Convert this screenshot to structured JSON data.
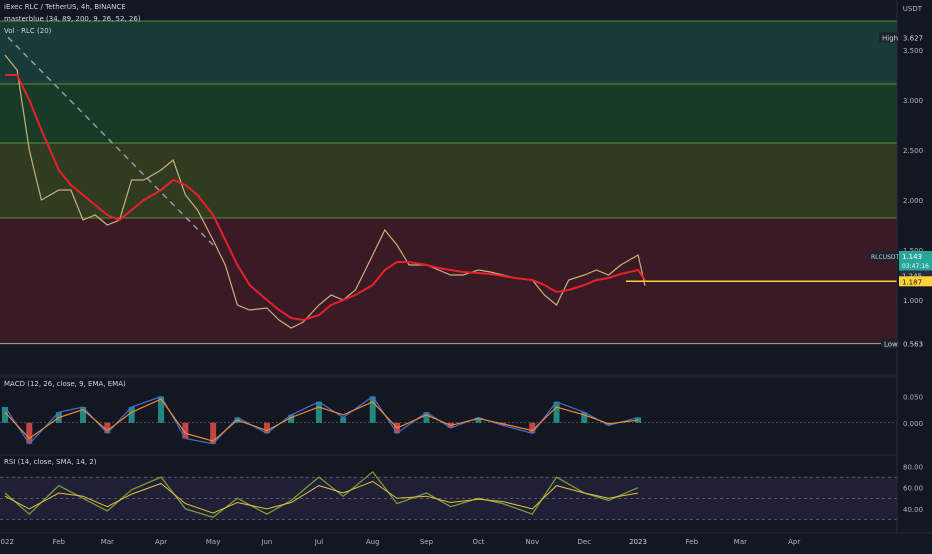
{
  "header": {
    "symbol_line": "iExec RLC / TetherUS, 4h, BINANCE",
    "indicator_line": "masterblue (34, 89, 200, 9, 26, 52, 26)",
    "volume_line": "Vol · RLC (20)",
    "currency": "USDT"
  },
  "price_axis": {
    "ticks": [
      "3.500",
      "3.000",
      "2.500",
      "2.000",
      "1.500",
      "1.000"
    ],
    "high_label": "High",
    "high_value": "3.627",
    "low_label": "Low",
    "low_value": "0.563",
    "symbol_badge": "RLCUSDT",
    "current_price": "1.143",
    "countdown": "03:47:16",
    "level_value_1": "1.245",
    "level_value_2": "1.187"
  },
  "macd": {
    "label": "MACD (12, 26, close, 9, EMA, EMA)",
    "ticks": [
      "0.050",
      "0.000"
    ]
  },
  "rsi": {
    "label": "RSI (14, close, SMA, 14, 2)",
    "ticks": [
      "80.00",
      "60.00",
      "40.00"
    ]
  },
  "time_axis": [
    "2022",
    "Feb",
    "Mar",
    "Apr",
    "May",
    "Jun",
    "Jul",
    "Aug",
    "Sep",
    "Oct",
    "Nov",
    "Dec",
    "2023",
    "Feb",
    "Mar",
    "Apr"
  ],
  "colors": {
    "background": "#131722",
    "zone_top": "#1e5a4a",
    "zone_green": "#1e5a2c",
    "zone_olive": "#4a5a1e",
    "zone_red": "#5a1e28",
    "ema_red": "#e8202e",
    "trendline": "#9598a1",
    "level_yellow": "#ffd23a",
    "macd_line": "#3f6fd8",
    "signal_line": "#f08a2e",
    "rsi_line": "#7a9a3a",
    "up": "#26a69a",
    "down": "#ef5350"
  },
  "chart_data": [
    {
      "type": "line",
      "title": "iExec RLC / TetherUS, 4h, BINANCE",
      "x": [
        "2022-01-01",
        "2022-01-08",
        "2022-01-15",
        "2022-01-22",
        "2022-02-01",
        "2022-02-08",
        "2022-02-15",
        "2022-02-22",
        "2022-03-01",
        "2022-03-08",
        "2022-03-15",
        "2022-03-22",
        "2022-04-01",
        "2022-04-08",
        "2022-04-15",
        "2022-04-22",
        "2022-05-01",
        "2022-05-08",
        "2022-05-15",
        "2022-05-22",
        "2022-06-01",
        "2022-06-08",
        "2022-06-15",
        "2022-06-22",
        "2022-07-01",
        "2022-07-08",
        "2022-07-15",
        "2022-07-22",
        "2022-08-01",
        "2022-08-08",
        "2022-08-15",
        "2022-08-22",
        "2022-09-01",
        "2022-09-08",
        "2022-09-15",
        "2022-09-22",
        "2022-10-01",
        "2022-10-08",
        "2022-10-15",
        "2022-10-22",
        "2022-11-01",
        "2022-11-08",
        "2022-11-15",
        "2022-11-22",
        "2022-12-01",
        "2022-12-08",
        "2022-12-15",
        "2022-12-22",
        "2023-01-01",
        "2023-01-05"
      ],
      "series": [
        {
          "values": [
            3.45,
            3.3,
            2.5,
            2.0,
            2.1,
            2.1,
            1.8,
            1.85,
            1.75,
            1.8,
            2.2,
            2.2,
            2.3,
            2.4,
            2.05,
            1.9,
            1.6,
            1.35,
            0.95,
            0.9,
            0.92,
            0.8,
            0.72,
            0.78,
            0.95,
            1.05,
            1.0,
            1.1,
            1.45,
            1.7,
            1.55,
            1.35,
            1.35,
            1.3,
            1.25,
            1.25,
            1.3,
            1.28,
            1.25,
            1.22,
            1.2,
            1.05,
            0.95,
            1.2,
            1.25,
            1.3,
            1.25,
            1.35,
            1.45,
            1.143
          ]
        },
        {
          "values": [
            3.25,
            3.25,
            3.0,
            2.7,
            2.3,
            2.15,
            2.05,
            1.95,
            1.85,
            1.8,
            1.9,
            2.0,
            2.1,
            2.2,
            2.15,
            2.05,
            1.85,
            1.6,
            1.35,
            1.15,
            1.0,
            0.9,
            0.82,
            0.8,
            0.85,
            0.95,
            1.0,
            1.05,
            1.15,
            1.3,
            1.38,
            1.38,
            1.35,
            1.32,
            1.3,
            1.28,
            1.27,
            1.26,
            1.24,
            1.22,
            1.2,
            1.15,
            1.08,
            1.1,
            1.15,
            1.2,
            1.22,
            1.26,
            1.3,
            1.2
          ]
        }
      ],
      "ylim": [
        0.5,
        3.7
      ],
      "horizontal_levels": [
        3.79,
        3.16,
        2.57,
        1.82,
        1.245,
        1.187,
        0.563
      ],
      "high": 3.627,
      "low": 0.563,
      "grid": false
    },
    {
      "type": "bar",
      "title": "MACD (12, 26, close, 9, EMA, EMA)",
      "ylim": [
        -0.05,
        0.07
      ],
      "x": [
        "2022-01-01",
        "2022-01-15",
        "2022-02-01",
        "2022-02-15",
        "2022-03-01",
        "2022-03-15",
        "2022-04-01",
        "2022-04-15",
        "2022-05-01",
        "2022-05-15",
        "2022-06-01",
        "2022-06-15",
        "2022-07-01",
        "2022-07-15",
        "2022-08-01",
        "2022-08-15",
        "2022-09-01",
        "2022-09-15",
        "2022-10-01",
        "2022-10-15",
        "2022-11-01",
        "2022-11-15",
        "2022-12-01",
        "2022-12-15",
        "2023-01-01"
      ],
      "series": [
        {
          "values": [
            0.03,
            -0.04,
            0.02,
            0.03,
            -0.02,
            0.03,
            0.05,
            -0.03,
            -0.04,
            0.01,
            -0.02,
            0.015,
            0.04,
            0.01,
            0.05,
            -0.02,
            0.02,
            -0.01,
            0.01,
            -0.005,
            -0.02,
            0.04,
            0.02,
            -0.005,
            0.01
          ]
        },
        {
          "values": [
            0.02,
            -0.03,
            0.01,
            0.025,
            -0.015,
            0.02,
            0.045,
            -0.02,
            -0.035,
            0.005,
            -0.015,
            0.01,
            0.03,
            0.015,
            0.04,
            -0.01,
            0.015,
            -0.005,
            0.008,
            -0.002,
            -0.015,
            0.03,
            0.015,
            -0.002,
            0.005
          ]
        }
      ]
    },
    {
      "type": "line",
      "title": "RSI (14, close, SMA, 14, 2)",
      "ylim": [
        20,
        90
      ],
      "x": [
        "2022-01-01",
        "2022-01-15",
        "2022-02-01",
        "2022-02-15",
        "2022-03-01",
        "2022-03-15",
        "2022-04-01",
        "2022-04-15",
        "2022-05-01",
        "2022-05-15",
        "2022-06-01",
        "2022-06-15",
        "2022-07-01",
        "2022-07-15",
        "2022-08-01",
        "2022-08-15",
        "2022-09-01",
        "2022-09-15",
        "2022-10-01",
        "2022-10-15",
        "2022-11-01",
        "2022-11-15",
        "2022-12-01",
        "2022-12-15",
        "2023-01-01"
      ],
      "series": [
        {
          "values": [
            55,
            35,
            62,
            50,
            38,
            58,
            70,
            40,
            32,
            50,
            35,
            48,
            70,
            52,
            75,
            45,
            55,
            42,
            50,
            45,
            35,
            70,
            55,
            48,
            60
          ]
        },
        {
          "values": [
            52,
            40,
            55,
            52,
            42,
            54,
            64,
            45,
            36,
            46,
            40,
            46,
            62,
            55,
            66,
            50,
            52,
            46,
            49,
            47,
            40,
            62,
            55,
            50,
            55
          ]
        }
      ],
      "bands": [
        70,
        50,
        30
      ]
    }
  ]
}
